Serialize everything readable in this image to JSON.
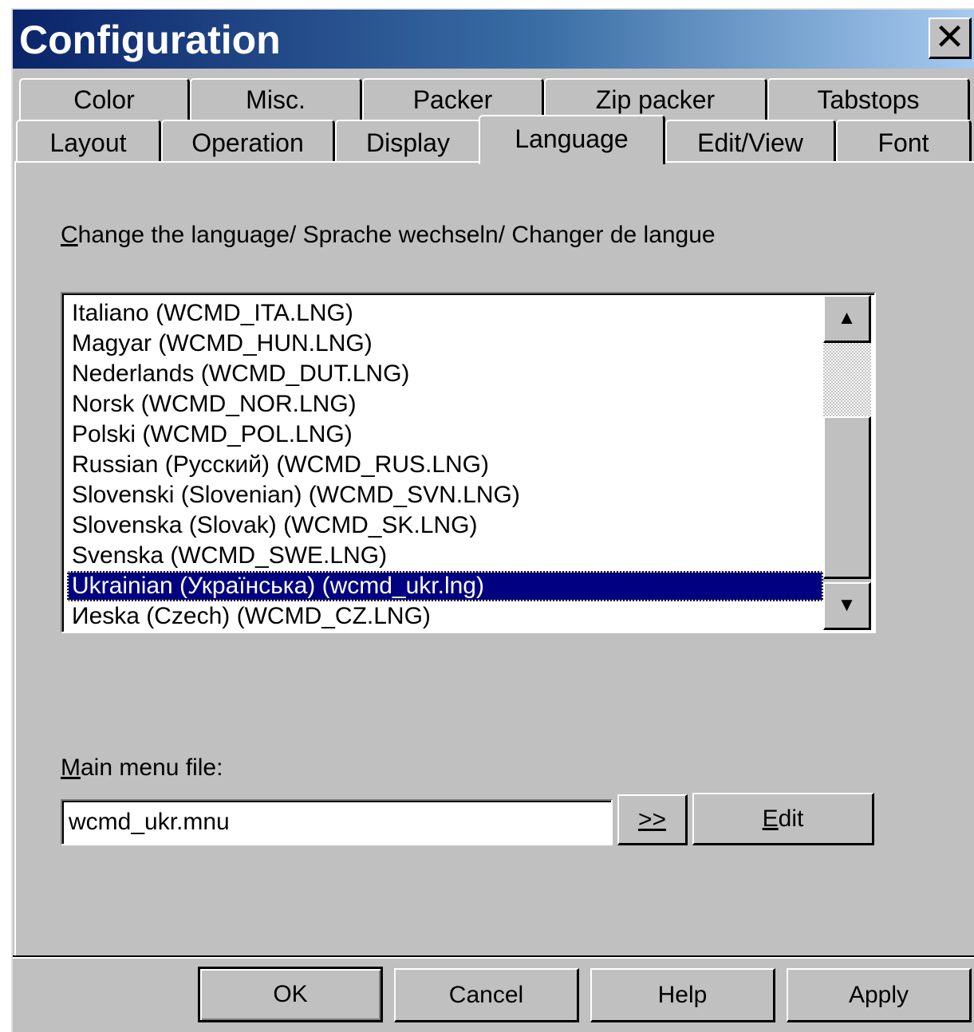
{
  "window": {
    "title": "Configuration",
    "close_glyph": "✕"
  },
  "tabs_row1": [
    {
      "label": "Color"
    },
    {
      "label": "Misc."
    },
    {
      "label": "Packer"
    },
    {
      "label": "Zip packer"
    },
    {
      "label": "Tabstops"
    }
  ],
  "tabs_row2": [
    {
      "label": "Layout"
    },
    {
      "label": "Operation"
    },
    {
      "label": "Display"
    },
    {
      "label": "Language",
      "active": true
    },
    {
      "label": "Edit/View"
    },
    {
      "label": "Font"
    }
  ],
  "language": {
    "label_first": "C",
    "label_rest": "hange the language/ Sprache wechseln/ Changer de langue",
    "items": [
      "Italiano (WCMD_ITA.LNG)",
      "Magyar (WCMD_HUN.LNG)",
      "Nederlands (WCMD_DUT.LNG)",
      "Norsk (WCMD_NOR.LNG)",
      "Polski (WCMD_POL.LNG)",
      "Russian (Русский) (WCMD_RUS.LNG)",
      "Slovenski (Slovenian) (WCMD_SVN.LNG)",
      "Slovenska (Slovak) (WCMD_SK.LNG)",
      "Svenska (WCMD_SWE.LNG)",
      "Ukrainian (Українська) (wcmd_ukr.lng)",
      "Иeska (Czech) (WCMD_CZ.LNG)"
    ],
    "selected": "Ukrainian (Українська) (wcmd_ukr.lng)",
    "scroll_up_glyph": "▲",
    "scroll_down_glyph": "▼"
  },
  "menu_file": {
    "label_first": "M",
    "label_rest": "ain menu file:",
    "value": "wcmd_ukr.mnu",
    "browse_label": ">>",
    "edit_first": "E",
    "edit_rest": "dit"
  },
  "buttons": {
    "ok": "OK",
    "cancel": "Cancel",
    "help": "Help",
    "apply": "Apply"
  },
  "colors": {
    "title_start": "#0a246a",
    "title_end": "#a6caf0",
    "face": "#c0c0c0",
    "selection": "#000080"
  }
}
